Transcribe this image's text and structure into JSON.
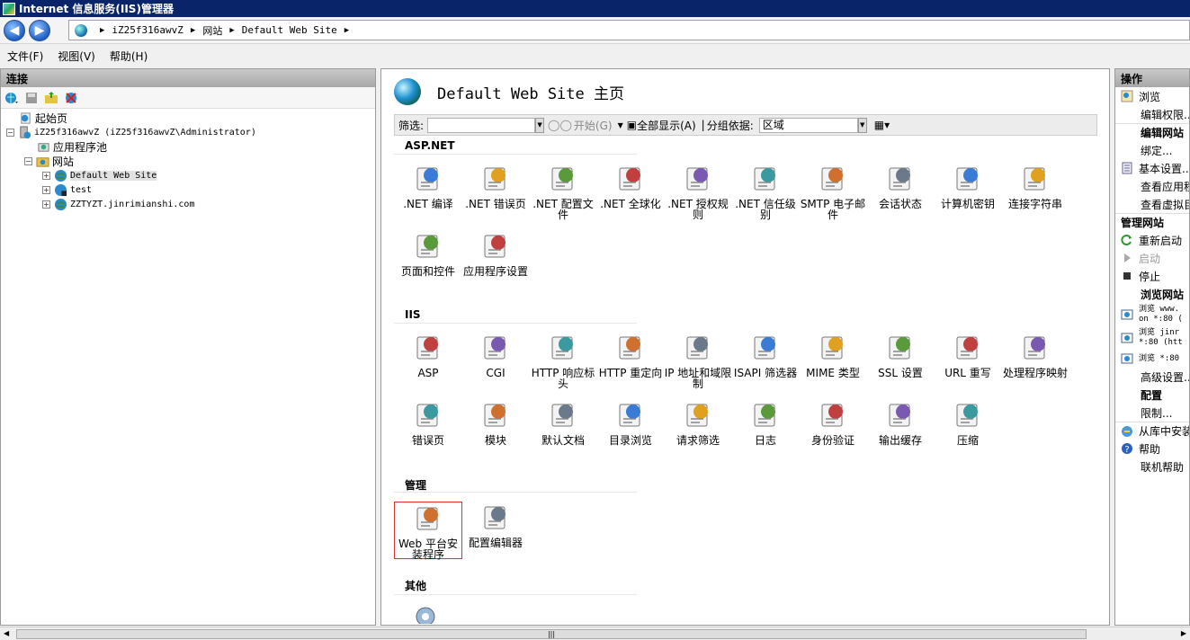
{
  "window": {
    "title": "Internet 信息服务(IIS)管理器"
  },
  "address": {
    "crumbs": [
      "iZ25f316awvZ",
      "网站",
      "Default Web Site"
    ]
  },
  "menu": [
    "文件(F)",
    "视图(V)",
    "帮助(H)"
  ],
  "left": {
    "header": "连接",
    "tree": [
      {
        "label": "起始页",
        "level": 0
      },
      {
        "label": "iZ25f316awvZ (iZ25f316awvZ\\Administrator)",
        "level": 0
      },
      {
        "label": "应用程序池",
        "level": 1
      },
      {
        "label": "网站",
        "level": 1
      },
      {
        "label": "Default Web Site",
        "level": 2
      },
      {
        "label": "test",
        "level": 2
      },
      {
        "label": "ZZTYZT.jinrimianshi.com",
        "level": 2
      }
    ]
  },
  "center": {
    "title": "Default Web Site 主页",
    "filter_label": "筛选:",
    "start_label": "开始(G)",
    "show_all_label": "全部显示(A)",
    "group_label": "分组依据:",
    "group_value": "区域",
    "sections": [
      {
        "title": "ASP.NET",
        "items": [
          ".NET 编译",
          ".NET 错误页",
          ".NET 配置文件",
          ".NET 全球化",
          ".NET 授权规则",
          ".NET 信任级别",
          "SMTP 电子邮件",
          "会话状态",
          "计算机密钥",
          "连接字符串",
          "页面和控件",
          "应用程序设置"
        ]
      },
      {
        "title": "IIS",
        "items": [
          "ASP",
          "CGI",
          "HTTP 响应标头",
          "HTTP 重定向",
          "IP 地址和域限制",
          "ISAPI 筛选器",
          "MIME 类型",
          "SSL 设置",
          "URL 重写",
          "处理程序映射",
          "错误页",
          "模块",
          "默认文档",
          "目录浏览",
          "请求筛选",
          "日志",
          "身份验证",
          "输出缓存",
          "压缩"
        ]
      },
      {
        "title": "管理",
        "items": [
          "Web 平台安装程序",
          "配置编辑器"
        ]
      },
      {
        "title": "其他",
        "items": []
      }
    ]
  },
  "right": {
    "header": "操作",
    "browse": "浏览",
    "edit_perm": "编辑权限...",
    "edit_site_head": "编辑网站",
    "bind": "绑定...",
    "basic": "基本设置...",
    "view_apps": "查看应用程",
    "view_vdirs": "查看虚拟目",
    "manage_head": "管理网站",
    "restart": "重新启动",
    "start": "启动",
    "stop": "停止",
    "browse_head": "浏览网站",
    "browse1": "浏览 www.",
    "browse1b": "on *:80 (",
    "browse2": "浏览 jinr",
    "browse2b": "*:80 (htt",
    "browse3": "浏览 *:80",
    "advanced": "高级设置...",
    "config_head": "配置",
    "limits": "限制...",
    "install_gallery": "从库中安装",
    "help": "帮助",
    "online_help": "联机帮助"
  }
}
